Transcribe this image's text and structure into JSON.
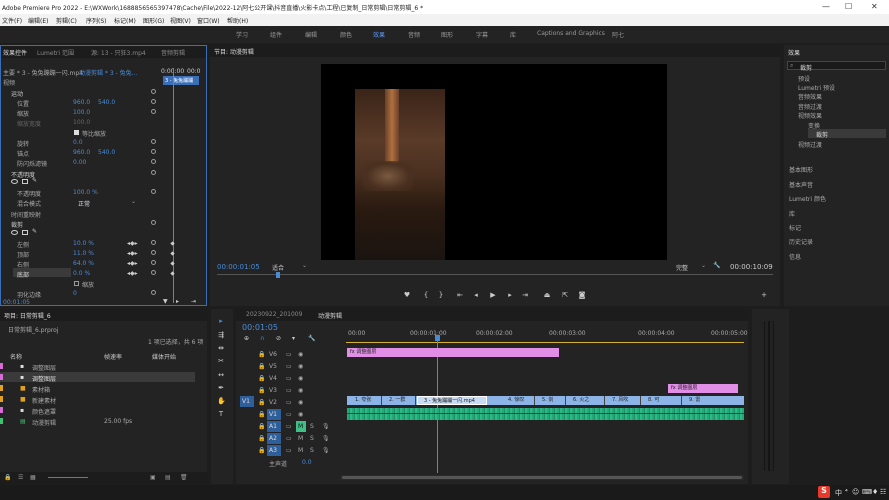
{
  "app": {
    "title": "Adobe Premiere Pro 2022 - E:\\WXWork\\1688856565397478\\Cache\\File\\2022-12\\阿七公开课\\抖音直播\\火影卡点\\工程\\已复制_日常剪辑\\日常剪辑_6 *",
    "minimize": "—",
    "maximize": "☐",
    "close": "✕"
  },
  "menu": [
    "文件(F)",
    "编辑(E)",
    "剪辑(C)",
    "序列(S)",
    "标记(M)",
    "图形(G)",
    "视图(V)",
    "窗口(W)",
    "帮助(H)"
  ],
  "workspaces": [
    "学习",
    "组件",
    "编辑",
    "颜色",
    "效果",
    "音频",
    "图形",
    "字幕",
    "库",
    "Captions and Graphics",
    "阿七"
  ],
  "workspace_active": "效果",
  "effect_controls": {
    "tabs": [
      "效果控件",
      "Lumetri 范围",
      "源: 13 - 只狂3.mp4",
      "音频剪辑"
    ],
    "master": "主要 * 3 - 兔兔蹦蹦一闪.mp4",
    "seq": "动漫剪辑 * 3 - 兔兔...",
    "time_a": "0:00:00",
    "time_b": "00:0",
    "clip_label": "3 - 兔兔蹦蹦",
    "section_video": "视频",
    "motion": "运动",
    "props": [
      {
        "name": "位置",
        "v1": "960.0",
        "v2": "540.0"
      },
      {
        "name": "缩放",
        "v1": "100.0",
        "v2": ""
      },
      {
        "name": "缩放宽度",
        "v1": "100.0",
        "v2": ""
      },
      {
        "name": "等比缩放",
        "v1": "",
        "v2": ""
      },
      {
        "name": "旋转",
        "v1": "0.0",
        "v2": ""
      },
      {
        "name": "锚点",
        "v1": "960.0",
        "v2": "540.0"
      },
      {
        "name": "防闪烁滤镜",
        "v1": "0.00",
        "v2": ""
      }
    ],
    "opacity": "不透明度",
    "opacity_sub": "不透明度",
    "opacity_val": "100.0 %",
    "blend": "混合模式",
    "blend_val": "正常",
    "remap": "时间重映射",
    "crop": "裁剪",
    "crop_props": [
      {
        "name": "左侧",
        "v": "10.0 %"
      },
      {
        "name": "顶部",
        "v": "11.0 %"
      },
      {
        "name": "右侧",
        "v": "64.0 %"
      },
      {
        "name": "底部",
        "v": "0.0 %"
      }
    ],
    "zoom": "缩放",
    "feather": "羽化边缘",
    "feather_val": "0",
    "time_bottom": "00:01:05"
  },
  "program": {
    "tab": "节目: 动漫剪辑",
    "time": "00:00:01:05",
    "fit": "适合",
    "quality": "完整",
    "duration": "00:00:10:09"
  },
  "effects": {
    "title": "效果",
    "search": "裁剪",
    "tree": [
      "预设",
      "Lumetri 预设",
      "音频效果",
      "音频过渡",
      "视频效果",
      "变换",
      "裁剪",
      "视频过渡"
    ],
    "panels": [
      "基本图形",
      "基本声音",
      "Lumetri 颜色",
      "库",
      "标记",
      "历史记录",
      "信息"
    ]
  },
  "project": {
    "tab": "项目: 日常剪辑_6",
    "file": "日常剪辑_6.prproj",
    "count": "1 项已选择，共 6 项",
    "cols": [
      "名称",
      "帧速率",
      "媒体开始"
    ],
    "items": [
      {
        "name": "调整图层",
        "rate": "",
        "start": "",
        "color": "#d66cd6"
      },
      {
        "name": "调整图层",
        "rate": "",
        "start": "",
        "color": "#d66cd6"
      },
      {
        "name": "素材箱",
        "rate": "",
        "start": "",
        "color": "#e0a020"
      },
      {
        "name": "新建素材",
        "rate": "",
        "start": "",
        "color": "#e0a020"
      },
      {
        "name": "颜色遮罩",
        "rate": "",
        "start": "",
        "color": "#d66cd6"
      },
      {
        "name": "动漫剪辑",
        "rate": "25.00 fps",
        "start": "",
        "color": "#40c070"
      }
    ]
  },
  "timeline": {
    "tabs": [
      "20230922_201009",
      "动漫剪辑"
    ],
    "time": "00:01:05",
    "ruler": [
      "00:00",
      "00:00:01:00",
      "00:00:02:00",
      "00:00:03:00",
      "00:00:04:00",
      "00:00:05:00"
    ],
    "tracks": [
      "V6",
      "V5",
      "V4",
      "V3",
      "V2",
      "V1",
      "A1",
      "A2",
      "A3"
    ],
    "master": "主声道",
    "master_val": "0.0",
    "clip_v5": "调整图层",
    "clip_v2": "调整图层",
    "v1_clips": [
      "1. 夸张",
      "2. 一群",
      "3 - 兔兔蹦蹦一闪.mp4",
      "4. 惊叹",
      "5. 剑",
      "6. 火之",
      "7. 风吹",
      "8. 可",
      "9. 雷"
    ]
  },
  "taskbar": [
    "中",
    "⁴",
    "☺",
    "⌨",
    "♦",
    "☷"
  ]
}
